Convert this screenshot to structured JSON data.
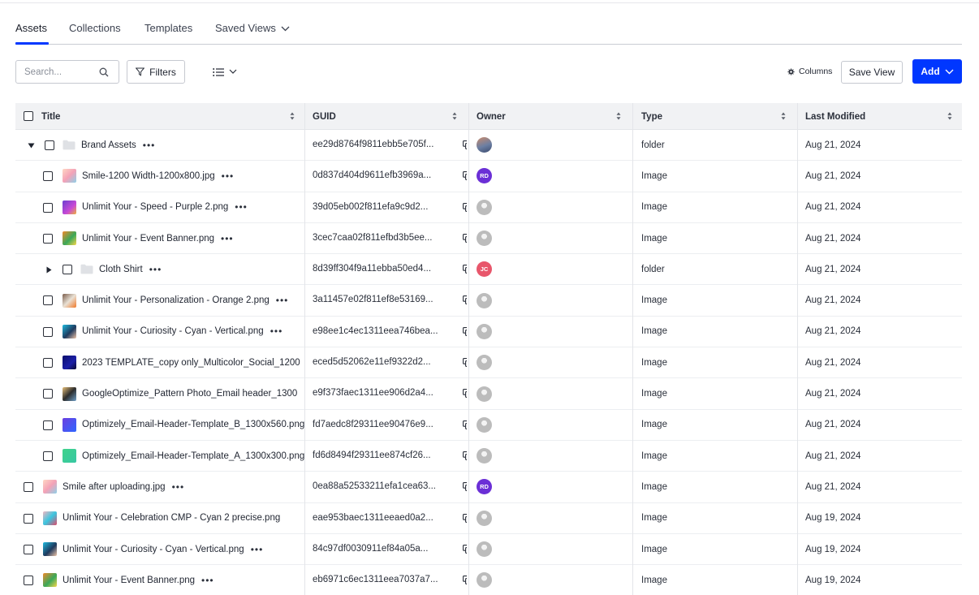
{
  "tabs": [
    {
      "label": "Assets",
      "active": true
    },
    {
      "label": "Collections",
      "active": false
    },
    {
      "label": "Templates",
      "active": false
    },
    {
      "label": "Saved Views",
      "active": false,
      "dropdown": true
    }
  ],
  "toolbar": {
    "search_placeholder": "Search...",
    "filters_label": "Filters",
    "columns_label": "Columns",
    "save_view_label": "Save View",
    "add_label": "Add"
  },
  "columns": [
    "Title",
    "GUID",
    "Owner",
    "Type",
    "Last Modified"
  ],
  "rows": [
    {
      "title": "Brand Assets",
      "guid": "ee29d8764f9811ebb5e705f...",
      "owner": "",
      "owner_style": "photo",
      "type": "folder",
      "modified": "Aug 21, 2024",
      "level": 0,
      "kind": "folder",
      "expanded": true,
      "more": true
    },
    {
      "title": "Smile-1200 Width-1200x800.jpg",
      "guid": "0d837d404d9611efb3969a...",
      "owner": "RD",
      "owner_style": "purple",
      "type": "Image",
      "modified": "Aug 21, 2024",
      "level": 1,
      "kind": "image",
      "thumb": "smile",
      "more": true
    },
    {
      "title": "Unlimit Your - Speed - Purple 2.png",
      "guid": "39d05eb002f811efa9c9d2...",
      "owner": "",
      "owner_style": "gray",
      "type": "Image",
      "modified": "Aug 21, 2024",
      "level": 1,
      "kind": "image",
      "thumb": "speed",
      "more": true
    },
    {
      "title": "Unlimit Your - Event Banner.png",
      "guid": "3cec7caa02f811efbd3b5ee...",
      "owner": "",
      "owner_style": "gray",
      "type": "Image",
      "modified": "Aug 21, 2024",
      "level": 1,
      "kind": "image",
      "thumb": "event",
      "more": true
    },
    {
      "title": "Cloth Shirt",
      "guid": "8d39ff304f9a11ebba50ed4...",
      "owner": "JC",
      "owner_style": "red",
      "type": "folder",
      "modified": "Aug 21, 2024",
      "level": 1,
      "kind": "folder",
      "expanded": false,
      "more": true
    },
    {
      "title": "Unlimit Your - Personalization - Orange 2.png",
      "guid": "3a11457e02f811ef8e53169...",
      "owner": "",
      "owner_style": "gray",
      "type": "Image",
      "modified": "Aug 21, 2024",
      "level": 1,
      "kind": "image",
      "thumb": "personal",
      "more": true
    },
    {
      "title": "Unlimit Your - Curiosity - Cyan - Vertical.png",
      "guid": "e98ee1c4ec1311eea746bea...",
      "owner": "",
      "owner_style": "gray",
      "type": "Image",
      "modified": "Aug 21, 2024",
      "level": 1,
      "kind": "image",
      "thumb": "curiosity",
      "more": true
    },
    {
      "title": "2023 TEMPLATE_copy only_Multicolor_Social_1200",
      "guid": "eced5d52062e11ef9322d2...",
      "owner": "",
      "owner_style": "gray",
      "type": "Image",
      "modified": "Aug 21, 2024",
      "level": 1,
      "kind": "image",
      "thumb": "template",
      "more": false
    },
    {
      "title": "GoogleOptimize_Pattern Photo_Email header_1300",
      "guid": "e9f373faec1311ee906d2a4...",
      "owner": "",
      "owner_style": "gray",
      "type": "Image",
      "modified": "Aug 21, 2024",
      "level": 1,
      "kind": "image",
      "thumb": "google",
      "more": false
    },
    {
      "title": "Optimizely_Email-Header-Template_B_1300x560.png",
      "guid": "fd7aedc8f29311ee90476e9...",
      "owner": "",
      "owner_style": "gray",
      "type": "Image",
      "modified": "Aug 21, 2024",
      "level": 1,
      "kind": "image",
      "thumb": "optB",
      "more": false
    },
    {
      "title": "Optimizely_Email-Header-Template_A_1300x300.png",
      "guid": "fd6d8494f29311ee874cf26...",
      "owner": "",
      "owner_style": "gray",
      "type": "Image",
      "modified": "Aug 21, 2024",
      "level": 1,
      "kind": "image",
      "thumb": "optA",
      "more": false
    },
    {
      "title": "Smile after uploading.jpg",
      "guid": "0ea88a52533211efa1cea63...",
      "owner": "RD",
      "owner_style": "purple",
      "type": "Image",
      "modified": "Aug 21, 2024",
      "level": 0,
      "kind": "image",
      "thumb": "smile",
      "more": true
    },
    {
      "title": "Unlimit Your - Celebration CMP - Cyan 2 precise.png",
      "guid": "eae953baec1311eeaed0a2...",
      "owner": "",
      "owner_style": "gray",
      "type": "Image",
      "modified": "Aug 19, 2024",
      "level": 0,
      "kind": "image",
      "thumb": "celebration",
      "more": false
    },
    {
      "title": "Unlimit Your - Curiosity - Cyan - Vertical.png",
      "guid": "84c97df0030911ef84a05a...",
      "owner": "",
      "owner_style": "gray",
      "type": "Image",
      "modified": "Aug 19, 2024",
      "level": 0,
      "kind": "image",
      "thumb": "curiosity",
      "more": true
    },
    {
      "title": "Unlimit Your - Event Banner.png",
      "guid": "eb6971c6ec1311eea7037a7...",
      "owner": "",
      "owner_style": "gray",
      "type": "Image",
      "modified": "Aug 19, 2024",
      "level": 0,
      "kind": "image",
      "thumb": "event",
      "more": true
    }
  ],
  "colors": {
    "accent": "#0037ff",
    "avatar_purple": "#6b2fd6",
    "avatar_red": "#e8566b",
    "header_bg": "#f1f2f4"
  },
  "thumbs": {
    "smile": "linear-gradient(135deg,#ffd7c4 0%,#f4a2b7 50%,#8ed0e8 100%)",
    "speed": "linear-gradient(135deg,#6a3fd0 0%,#c84ad6 60%,#f0b33a 100%)",
    "event": "linear-gradient(135deg,#f08a2b 0%,#3aa85a 55%,#f7d64a 100%)",
    "personal": "linear-gradient(135deg,#7a5c4a 0%,#e9e1d5 50%,#f07a2a 100%)",
    "curiosity": "linear-gradient(135deg,#1fbadf 0%,#1e3a5e 55%,#f2c6a8 100%)",
    "template": "linear-gradient(135deg,#0c0f6b 0%,#1b1fa8 60%,#0a0a30 100%)",
    "google": "linear-gradient(135deg,#e8c07a 0%,#2d2d2d 50%,#6fa0c8 100%)",
    "optB": "linear-gradient(135deg,#6b3fe0 0%,#2f66ff 100%)",
    "optA": "linear-gradient(135deg,#3fd38b 0%,#38c7a3 100%)",
    "celebration": "linear-gradient(135deg,#f2b7c2 0%,#3ac6e0 50%,#e04a6a 100%)"
  }
}
